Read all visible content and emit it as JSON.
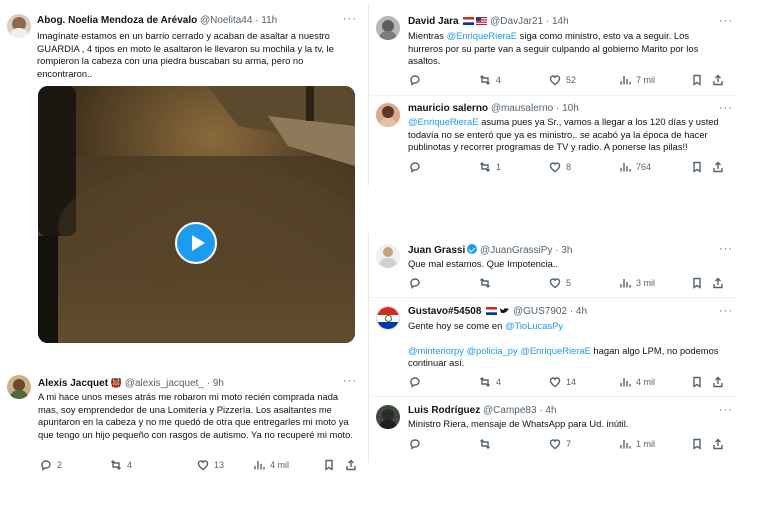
{
  "tweets": {
    "noelia": {
      "name": "Abog. Noelia Mendoza de Arévalo",
      "handle": "@Noelita44",
      "time": "· 11h",
      "text": "Imagínate estamos en un barrio cerrado y acaban de asaltar a nuestro GUARDIA , 4 tipos en moto le asaltaron le llevaron su mochila y la tv, le rompieron la cabeza con una piedra buscaban su arma, pero no encontraron.."
    },
    "alexis": {
      "name": "Alexis Jacquet",
      "badge": "👹",
      "handle": "@alexis_jacquet_",
      "time": "· 9h",
      "text": "A mi hace unos meses atrás me robaron mi moto recién comprada nada mas, soy emprendedor de una Lomitería y Pizzería. Los asaltantes me apuntaron en la cabeza y no me quedó de otra que entregarles mi moto ya que tengo un hijo pequeño con rasgos de autismo. Ya no recuperé mi moto.",
      "replies": "2",
      "retweets": "4",
      "likes": "13",
      "views": "4 mil"
    },
    "david": {
      "name": "David Jara",
      "handle": "@DavJar21",
      "time": "· 14h",
      "text_pre": "Mientras ",
      "mention": "@EnriqueRieraE",
      "text_post": " siga como ministro, esto va a seguir. Los hurreros por su parte van a seguir culpando al gobierno Marito por los asaltos.",
      "replies": "",
      "retweets": "4",
      "likes": "52",
      "views": "7 mil"
    },
    "mauricio": {
      "name": "mauricio salerno",
      "handle": "@mausalerno",
      "time": "· 10h",
      "mention": "@EnriqueRieraE",
      "text_post": " asuma pues ya Sr., vamos a llegar a los 120 días y usted todavía no se enteró que ya es ministro.. se acabó ya la época de hacer publinotas y recorrer programas de TV y radio. A ponerse las pilas!!",
      "replies": "",
      "retweets": "1",
      "likes": "8",
      "views": "764"
    },
    "juan": {
      "name": "Juan Grassi",
      "handle": "@JuanGrassiPy",
      "time": "· 3h",
      "text": "Que mal estamos. Que Impotencia..",
      "replies": "",
      "retweets": "",
      "likes": "5",
      "views": "3 mil"
    },
    "gustavo": {
      "name": "Gustavo#54508",
      "handle": "@GUS7902",
      "time": "· 4h",
      "text_pre": "Gente hoy se come en ",
      "mention1": "@TioLucasPy",
      "mention2": "@minteriorpy",
      "mention3": "@policia_py",
      "mention4": "@EnriqueRieraE",
      "text_post": " hagan algo LPM, no podemos continuar así.",
      "replies": "",
      "retweets": "4",
      "likes": "14",
      "views": "4 mil"
    },
    "luis": {
      "name": "Luis Rodríguez",
      "handle": "@Campe83",
      "time": "· 4h",
      "text": "Ministro Riera, mensaje de WhatsApp para Ud. inútil.",
      "replies": "",
      "retweets": "",
      "likes": "7",
      "views": "1 mil"
    }
  },
  "icons": {
    "reply": "reply-icon",
    "retweet": "retweet-icon",
    "like": "like-icon",
    "views": "views-icon",
    "bookmark": "bookmark-icon",
    "share": "share-icon",
    "more": "more-icon",
    "play": "play-icon"
  },
  "colors": {
    "link": "#1d9bf0",
    "play": "#1d9bf0",
    "muted": "#536471"
  }
}
